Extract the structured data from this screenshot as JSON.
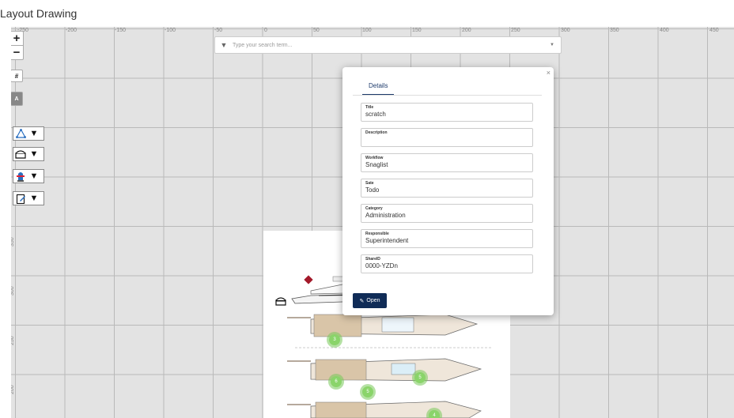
{
  "page": {
    "title": "Layout Drawing"
  },
  "axis": {
    "x_ticks": [
      "-250",
      "-200",
      "-150",
      "-100",
      "-50",
      "0",
      "50",
      "100",
      "150",
      "200",
      "250",
      "300",
      "350",
      "400",
      "450"
    ],
    "y_ticks": [
      "350",
      "300",
      "250",
      "200"
    ]
  },
  "controls": {
    "zoom_in": "+",
    "zoom_out": "−",
    "hash": "#",
    "a_label": "A"
  },
  "search": {
    "placeholder": "Type your search term..."
  },
  "popup": {
    "tab": "Details",
    "fields": [
      {
        "label": "Title",
        "value": "scratch"
      },
      {
        "label": "Description",
        "value": ""
      },
      {
        "label": "Workflow",
        "value": "Snaglist"
      },
      {
        "label": "Sate",
        "value": "Todo"
      },
      {
        "label": "Category",
        "value": "Administration"
      },
      {
        "label": "Responsible",
        "value": "Superintendent"
      },
      {
        "label": "ShareID",
        "value": "0000-YZDn"
      }
    ],
    "open_label": "Open",
    "close_glyph": "×"
  },
  "clusters": [
    "3",
    "6",
    "5",
    "5",
    "4"
  ],
  "icons": [
    "triangle-nodes-icon",
    "filter-icon",
    "treasure-chest-icon",
    "fire-hydrant-icon",
    "clipboard-edit-icon",
    "search-filter-icon",
    "edit-icon"
  ]
}
